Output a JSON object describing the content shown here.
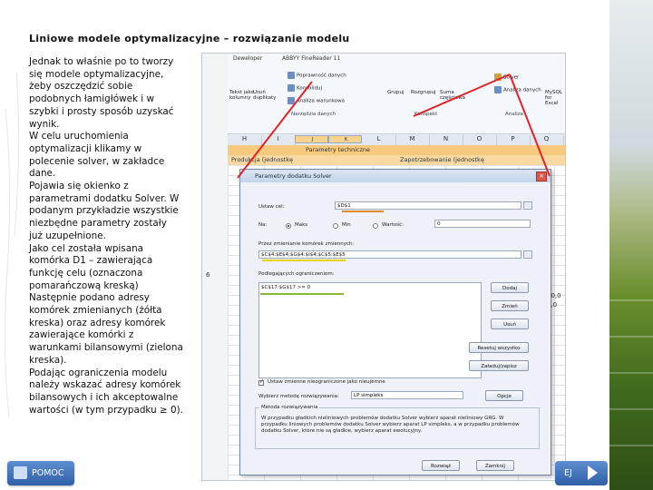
{
  "slide": {
    "title": "Liniowe modele optymalizacyjne – rozwiązanie modelu",
    "paragraph": [
      "Jednak to właśnie po to tworzy się modele optymalizacyjne, żeby oszczędzić sobie podobnych łamigłówek i w szybki i prosty sposób uzyskać wynik.",
      "W celu uruchomienia optymalizacji klikamy w polecenie solver, w zakładce dane.",
      "Pojawia się okienko z parametrami dodatku Solver. W podanym przykładzie wszystkie niezbędne parametry zostały już uzupełnione.",
      "Jako cel została wpisana komórka D1 – zawierająca funkcję celu (oznaczona pomarańczową kreską)",
      "Następnie podano adresy komórek zmienianych (żółta kreska) oraz adresy komórek zawierające komórki z warunkami bilansowymi (zielona kreska).",
      "Podając ograniczenia modelu należy wskazać adresy komórek bilansowych i ich akceptowalne wartości (w tym przypadku ≥ 0)."
    ]
  },
  "ribbon": {
    "tabs": [
      "Deweloper",
      "ABBYY FineReader 11"
    ],
    "buttons": [
      "Tekst jako kolumny",
      "Usuń duplikaty",
      "Poprawność danych",
      "Konsoliduj",
      "Analiza warunkowa",
      "Grupuj",
      "Rozgrupuj",
      "Suma częściowa",
      "Solver",
      "Analiza danych",
      "MySQL for Excel"
    ],
    "groups": [
      "Narzędzia danych",
      "Konspekt",
      "Analiza"
    ]
  },
  "sheet": {
    "columns": [
      "H",
      "I",
      "J",
      "K",
      "L",
      "M",
      "N",
      "O",
      "P",
      "Q"
    ],
    "band1": "Parametry techniczne",
    "band2_left": "Produkcja (jednostkę",
    "band2_right": "Zapotrzebowanie (jednostkę",
    "side_values": [
      "6",
      "50,0",
      "0,0"
    ]
  },
  "dialog": {
    "title": "Parametry dodatku Solver",
    "objective_label": "Ustaw cel:",
    "objective_value": "$D$1",
    "to_label": "Na:",
    "opt_max": "Maks",
    "opt_min": "Min",
    "opt_value": "Wartość:",
    "value_field": "0",
    "changing_label": "Przez zmienianie komórek zmiennych:",
    "changing_value": "$C$4:$E$4;$G$4:$I$4;$C$5:$E$5",
    "constraints_label": "Podlegających ograniczeniom:",
    "constraint_item": "$C$17:$G$17 >= 0",
    "btn_add": "Dodaj",
    "btn_change": "Zmień",
    "btn_delete": "Usuń",
    "btn_reset": "Resetuj wszystko",
    "btn_load": "Załaduj/zapisz",
    "unconstrained_label": "Ustaw zmienne nieograniczone jako nieujemne",
    "method_label": "Wybierz metodę rozwiązywania:",
    "method_value": "LP simpleks",
    "btn_options": "Opcje",
    "method_section": "Metoda rozwiązywania",
    "method_desc": "W przypadku gładkich nieliniowych problemów dodatku Solver wybierz aparat nieliniowy GRG. W przypadku liniowych problemów dodatku Solver wybierz aparat LP simpleks, a w przypadku problemów dodatku Solver, które nie są gładkie, wybierz aparat ewolucyjny.",
    "btn_solve": "Rozwiąż",
    "btn_close": "Zamknij"
  },
  "nav": {
    "help_label": "POMOC",
    "next_label": "EJ"
  },
  "colors": {
    "orange_mark": "#e38a2c",
    "yellow_mark": "#e8d400",
    "green_mark": "#86b63a",
    "red_arrow": "#e0242a",
    "nav_blue": "#2f5fa6"
  }
}
